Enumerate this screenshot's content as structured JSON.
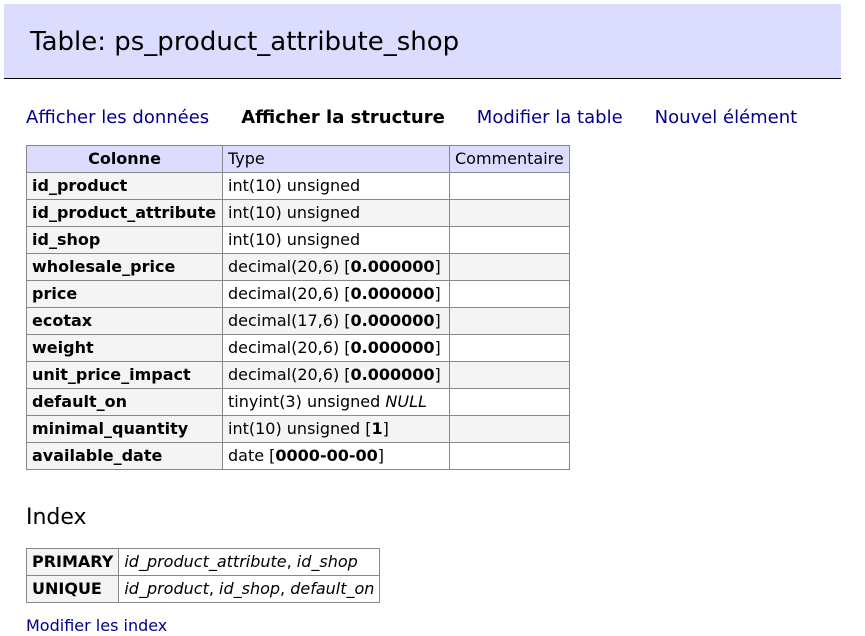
{
  "page": {
    "title": "Table: ps_product_attribute_shop"
  },
  "nav": {
    "show_data": "Afficher les données",
    "show_structure": "Afficher la structure",
    "alter_table": "Modifier la table",
    "new_item": "Nouvel élément"
  },
  "structure": {
    "headers": [
      "Colonne",
      "Type",
      "Commentaire"
    ],
    "rows": [
      {
        "name": "id_product",
        "type": "int(10) unsigned",
        "default": "",
        "comment": ""
      },
      {
        "name": "id_product_attribute",
        "type": "int(10) unsigned",
        "default": "",
        "comment": ""
      },
      {
        "name": "id_shop",
        "type": "int(10) unsigned",
        "default": "",
        "comment": ""
      },
      {
        "name": "wholesale_price",
        "type": "decimal(20,6)",
        "default": "0.000000",
        "comment": ""
      },
      {
        "name": "price",
        "type": "decimal(20,6)",
        "default": "0.000000",
        "comment": ""
      },
      {
        "name": "ecotax",
        "type": "decimal(17,6)",
        "default": "0.000000",
        "comment": ""
      },
      {
        "name": "weight",
        "type": "decimal(20,6)",
        "default": "0.000000",
        "comment": ""
      },
      {
        "name": "unit_price_impact",
        "type": "decimal(20,6)",
        "default": "0.000000",
        "comment": ""
      },
      {
        "name": "default_on",
        "type": "tinyint(3) unsigned",
        "null_label": "NULL",
        "comment": ""
      },
      {
        "name": "minimal_quantity",
        "type": "int(10) unsigned",
        "default": "1",
        "comment": ""
      },
      {
        "name": "available_date",
        "type": "date",
        "default": "0000-00-00",
        "comment": ""
      }
    ]
  },
  "index": {
    "title": "Index",
    "rows": [
      {
        "type": "PRIMARY",
        "columns": [
          "id_product_attribute",
          "id_shop"
        ]
      },
      {
        "type": "UNIQUE",
        "columns": [
          "id_product",
          "id_shop",
          "default_on"
        ]
      }
    ]
  },
  "footer": {
    "alter_indexes": "Modifier les index"
  }
}
